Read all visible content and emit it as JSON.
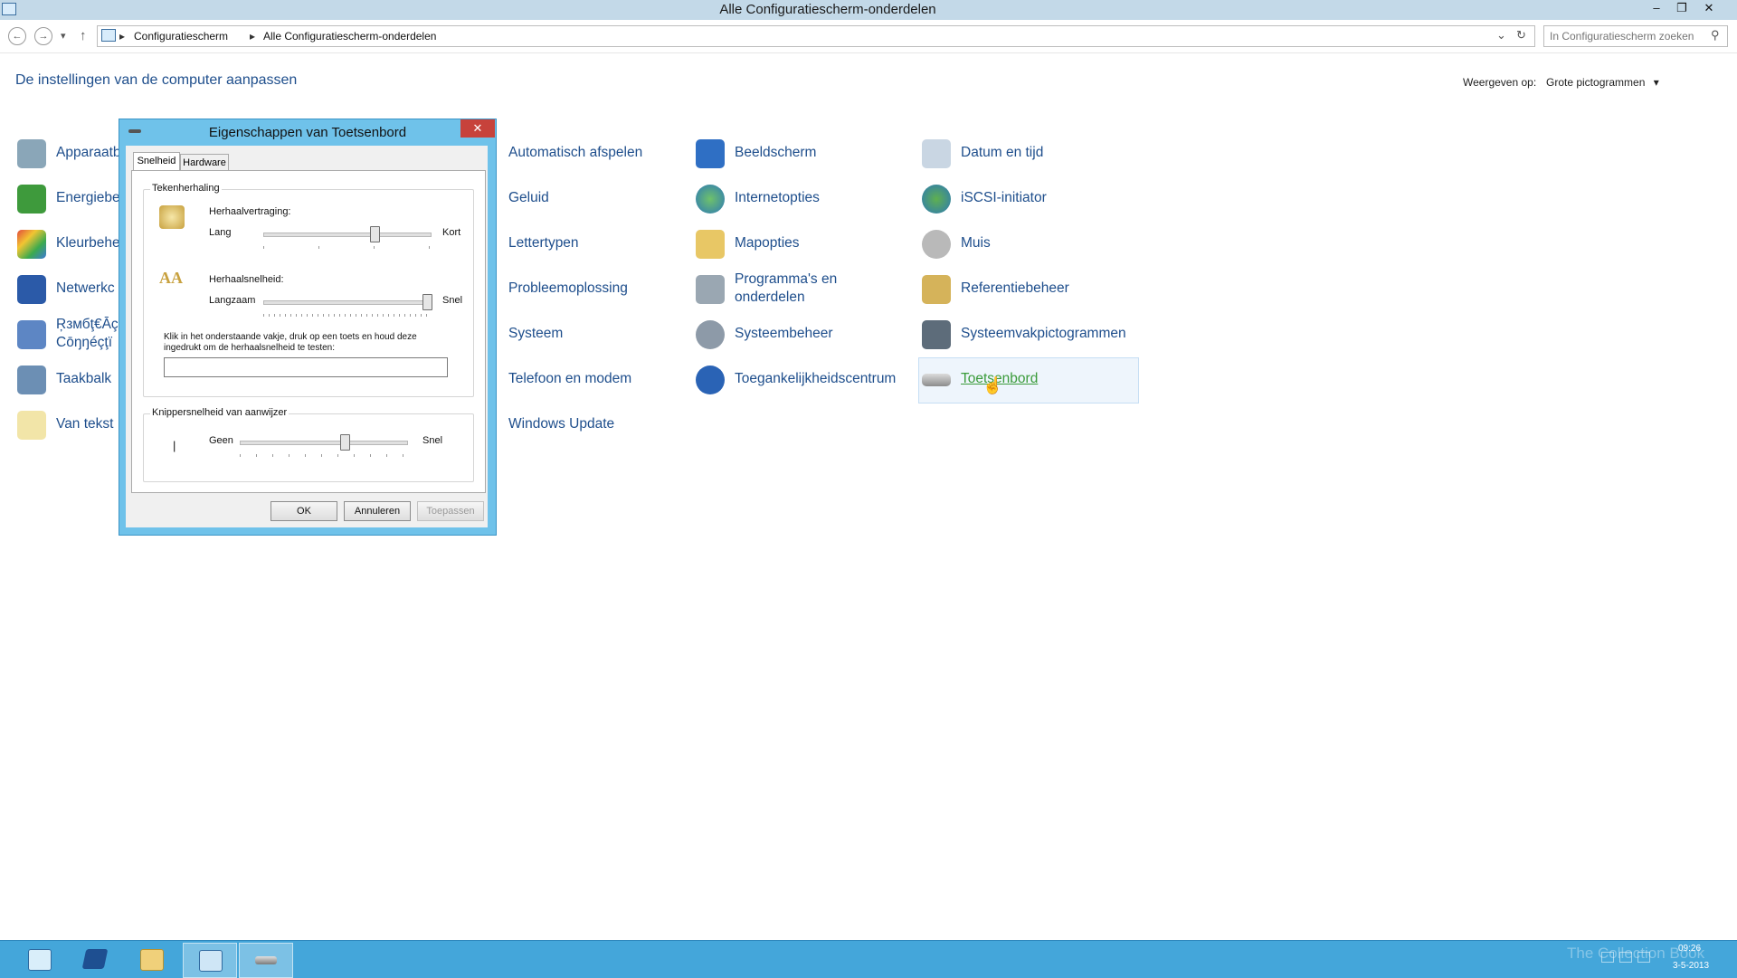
{
  "window": {
    "title": "Alle Configuratiescherm-onderdelen",
    "minimize_label": "‒",
    "restore_label": "❐",
    "close_label": "✕"
  },
  "nav": {
    "back_icon": "←",
    "forward_icon": "→",
    "recent_icon": "▾",
    "up_icon": "↑",
    "crumbs": [
      "Configuratiescherm",
      "Alle Configuratiescherm-onderdelen"
    ],
    "separator": "▸",
    "dropdown_icon": "⌄",
    "refresh_icon": "↻",
    "search_placeholder": "In Configuratiescherm zoeken",
    "search_icon": "⚲"
  },
  "page": {
    "heading": "De instellingen van de computer aanpassen",
    "view_label": "Weergeven op:",
    "view_value": "Grote pictogrammen",
    "view_arrow": "▾"
  },
  "items": {
    "col1": [
      "Apparaatb",
      "Energiebe",
      "Kleurbehe",
      "Netwerkc",
      "Ŗзмбţ€Āç Cōŋŋéçţï",
      "Taakbalk",
      "Van tekst"
    ],
    "col2": [
      "Automatisch afspelen",
      "Geluid",
      "Lettertypen",
      "Probleemoplossing",
      "Systeem",
      "Telefoon en modem",
      "Windows Update"
    ],
    "col3": [
      "Beeldscherm",
      "Internetopties",
      "Mapopties",
      "Programma's en onderdelen",
      "Systeembeheer",
      "Toegankelijkheidscentrum"
    ],
    "col4": [
      "Datum en tijd",
      "iSCSI-initiator",
      "Muis",
      "Referentiebeheer",
      "Systeemvakpictogrammen",
      "Toetsenbord"
    ]
  },
  "colors": {
    "link": "#1e4e8c",
    "link_hover": "#3a9b3a",
    "dialog_frame": "#6fc2ea",
    "taskbar": "#44a6da"
  },
  "dialog": {
    "title": "Eigenschappen van Toetsenbord",
    "close_label": "✕",
    "tabs": [
      "Snelheid",
      "Hardware"
    ],
    "group1_label": "Tekenherhaling",
    "delay_label": "Herhaalvertraging:",
    "delay_min": "Lang",
    "delay_max": "Kort",
    "delay_value": 0.67,
    "rate_label": "Herhaalsnelheid:",
    "rate_min": "Langzaam",
    "rate_max": "Snel",
    "rate_value": 1.0,
    "test_label": "Klik in het onderstaande vakje, druk op een toets en houd deze ingedrukt om de herhaalsnelheid te testen:",
    "test_value": "",
    "group2_label": "Knippersnelheid van aanwijzer",
    "cursor_glyph": "|",
    "blink_min": "Geen",
    "blink_max": "Snel",
    "blink_value": 0.63,
    "ok": "OK",
    "cancel": "Annuleren",
    "apply": "Toepassen"
  },
  "taskbar": {
    "buttons": [
      "server-manager-icon",
      "powershell-icon",
      "explorer-icon",
      "control-panel-icon",
      "keyboard-icon"
    ],
    "watermark": "The Collection Book",
    "time": "09:26",
    "date": "3-5-2013"
  }
}
